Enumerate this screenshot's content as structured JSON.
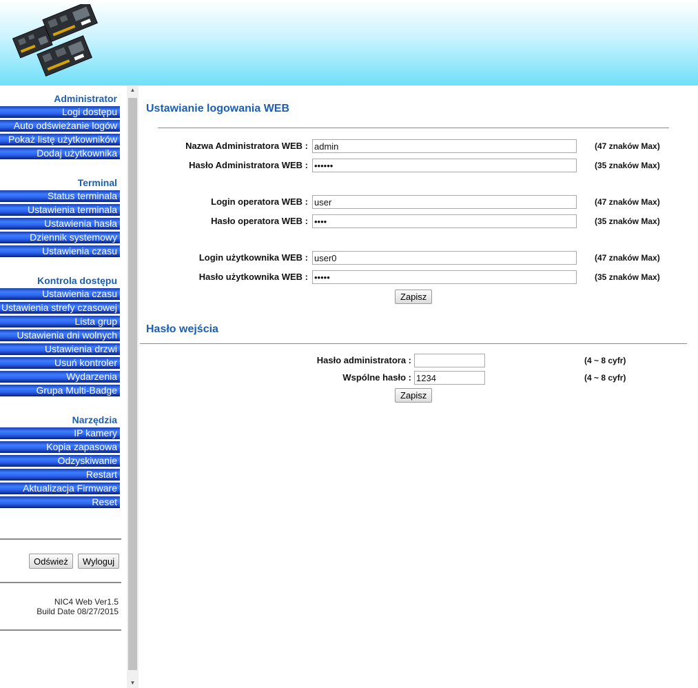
{
  "sidebar": {
    "sections": [
      {
        "title": "Administrator",
        "items": [
          "Logi dostępu",
          "Auto odświeżanie logów",
          "Pokaż listę użytkowników",
          "Dodaj użytkownika"
        ]
      },
      {
        "title": "Terminal",
        "items": [
          "Status terminala",
          "Ustawienia terminala",
          "Ustawienia hasła",
          "Dziennik systemowy",
          "Ustawienia czasu"
        ]
      },
      {
        "title": "Kontrola dostępu",
        "items": [
          "Ustawienia czasu",
          "Ustawienia strefy czasowej",
          "Lista grup",
          "Ustawienia dni wolnych",
          "Ustawienia drzwi",
          "Usuń kontroler",
          "Wydarzenia",
          "Grupa Multi-Badge"
        ]
      },
      {
        "title": "Narzędzia",
        "items": [
          "IP kamery",
          "Kopia zapasowa",
          "Odzyskiwanie",
          "Restart",
          "Aktualizacja Firmware",
          "Reset"
        ]
      }
    ],
    "refresh_label": "Odśwież",
    "logout_label": "Wyloguj",
    "version": "NIC4 Web Ver1.5",
    "build_date": "Build Date 08/27/2015"
  },
  "web_login": {
    "title": "Ustawianie logowania WEB",
    "fields": [
      {
        "label": "Nazwa Administratora WEB :",
        "value": "admin",
        "type": "text",
        "hint": "(47 znaków Max)"
      },
      {
        "label": "Hasło Administratora WEB :",
        "value": "secret",
        "type": "password",
        "hint": "(35 znaków Max)"
      },
      {
        "label": "Login operatora WEB :",
        "value": "user",
        "type": "text",
        "hint": "(47 znaków Max)"
      },
      {
        "label": "Hasło operatora WEB :",
        "value": "oper",
        "type": "password",
        "hint": "(35 znaków Max)"
      },
      {
        "label": "Login użytkownika WEB :",
        "value": "user0",
        "type": "text",
        "hint": "(47 znaków Max)"
      },
      {
        "label": "Hasło użytkownika WEB :",
        "value": "user0",
        "type": "password",
        "hint": "(35 znaków Max)"
      }
    ],
    "save_label": "Zapisz"
  },
  "entry_password": {
    "title": "Hasło wejścia",
    "fields": [
      {
        "label": "Hasło administratora :",
        "value": "",
        "hint": "(4 ~ 8 cyfr)"
      },
      {
        "label": "Wspólne hasło :",
        "value": "1234",
        "hint": "(4 ~ 8 cyfr)"
      }
    ],
    "save_label": "Zapisz"
  }
}
